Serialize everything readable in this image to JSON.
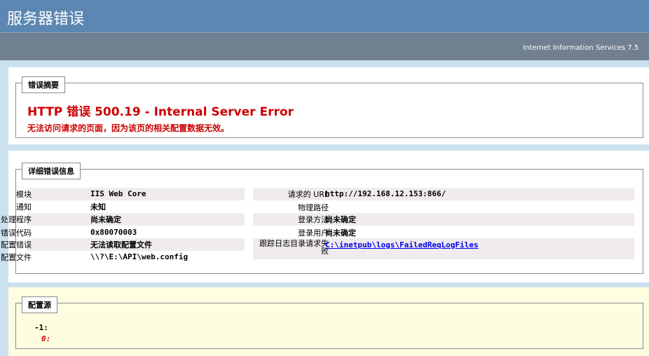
{
  "header": {
    "title": "服务器错误"
  },
  "subheader": {
    "text": "Internet Information Services 7.5"
  },
  "summary": {
    "legend": "错误摘要",
    "title": "HTTP 错误 500.19 - Internal Server Error",
    "description": "无法访问请求的页面，因为该页的相关配置数据无效。"
  },
  "details": {
    "legend": "详细错误信息",
    "left": [
      {
        "label": "模块",
        "value": "IIS Web Core"
      },
      {
        "label": "通知",
        "value": "未知"
      },
      {
        "label": "处理程序",
        "value": "尚未确定"
      },
      {
        "label": "错误代码",
        "value": "0x80070003"
      },
      {
        "label": "配置错误",
        "value": "无法读取配置文件"
      },
      {
        "label": "配置文件",
        "value": "\\\\?\\E:\\API\\web.config"
      }
    ],
    "right": [
      {
        "label": "请求的 URL",
        "value": "http://192.168.12.153:866/"
      },
      {
        "label": "物理路径",
        "value": ""
      },
      {
        "label": "登录方法",
        "value": "尚未确定"
      },
      {
        "label": "登录用户",
        "value": "尚未确定"
      },
      {
        "label": "跟踪日志目录",
        "value": "C:\\inetpub\\logs\\FailedReqLogFiles"
      }
    ],
    "trace_label_line1": "请求失",
    "trace_label_line2": "败"
  },
  "config_source": {
    "legend": "配置源",
    "lines": [
      "-1:",
      "0:"
    ]
  },
  "colors": {
    "header_bg": "#5C87B2",
    "subheader_bg": "#708090",
    "error_red": "#CC0000",
    "page_bg": "#CBE1EF",
    "source_bg": "#FFFDE0"
  }
}
